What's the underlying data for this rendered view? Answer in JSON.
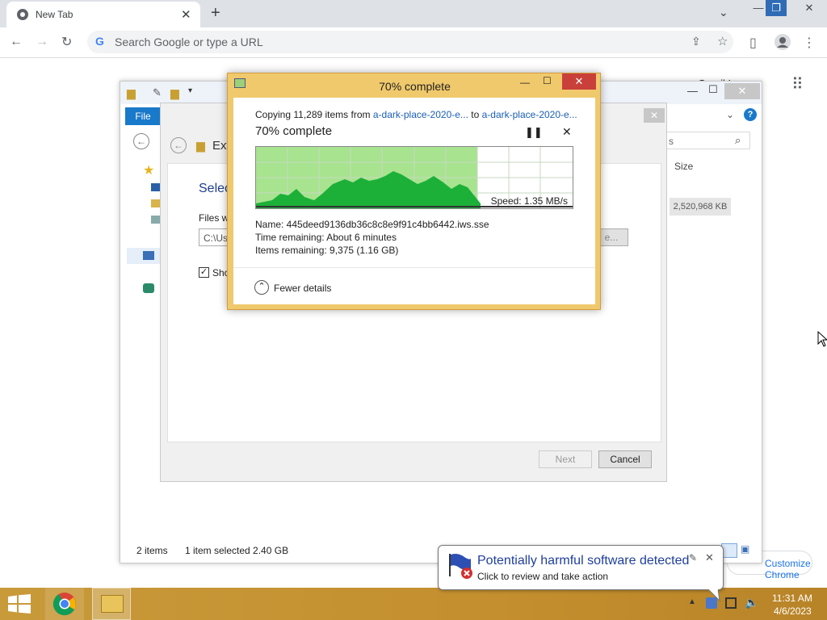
{
  "chrome": {
    "tab_title": "New Tab",
    "omnibox_placeholder": "Search Google or type a URL",
    "right_link": "Gmail  Images",
    "customize_label": "Customize Chrome"
  },
  "explorer": {
    "ribbon_file": "File",
    "breadcrumb_tail": "Ext",
    "search_tail": "s",
    "column_size": "Size",
    "size_value": "2,520,968 KB",
    "status_items": "2 items",
    "status_selected": "1 item selected  2.40 GB"
  },
  "wizard": {
    "heading": "Selec",
    "files_label": "Files wi",
    "path_value": "C:\\Use",
    "browse_label": "e...",
    "show_label": "Sho",
    "next_label": "Next",
    "cancel_label": "Cancel"
  },
  "copy_dialog": {
    "title": "70% complete",
    "copying_prefix": "Copying 11,289 items from",
    "source": "a-dark-place-2020-e...",
    "to_word": "to",
    "destination": "a-dark-place-2020-e...",
    "progress_heading": "70% complete",
    "progress_fraction": 0.7,
    "speed": "Speed: 1.35 MB/s",
    "name_line": "Name:  445deed9136db36c8c8e9f91c4bb6442.iws.sse",
    "time_line": "Time remaining:  About 6 minutes",
    "items_line": "Items remaining:  9,375 (1.16 GB)",
    "fewer_details": "Fewer details"
  },
  "notification": {
    "title": "Potentially harmful software detected",
    "subtitle": "Click to review and take action"
  },
  "taskbar": {
    "time": "11:31 AM",
    "date": "4/6/2023"
  }
}
